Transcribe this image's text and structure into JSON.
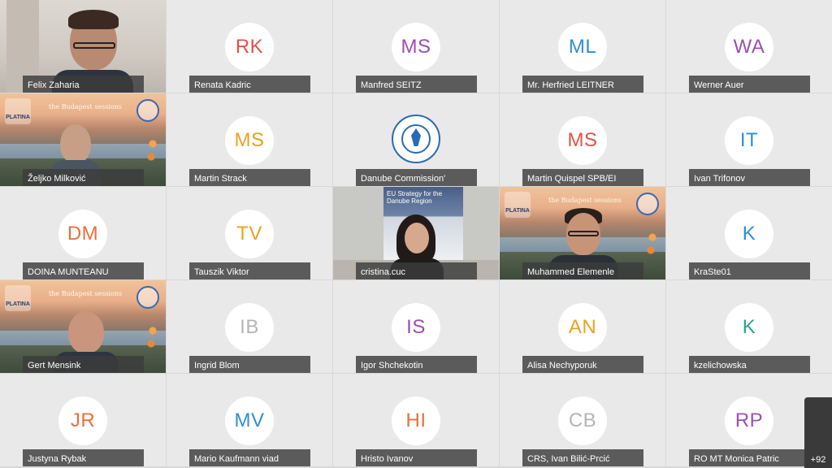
{
  "meeting": {
    "participants": [
      {
        "name": "Felix Zaharia",
        "type": "video"
      },
      {
        "name": "Renata Kadric",
        "initials": "RK",
        "color": "#e0524a"
      },
      {
        "name": "Manfred SEITZ",
        "initials": "MS",
        "color": "#9b4fb0"
      },
      {
        "name": "Mr. Herfried LEITNER",
        "initials": "ML",
        "color": "#2e8fd4"
      },
      {
        "name": "Werner Auer",
        "initials": "WA",
        "color": "#9b4fb0"
      },
      {
        "name": "Željko Milković",
        "type": "video-budapest",
        "banner": "the Budapest sessions"
      },
      {
        "name": "Martin Strack",
        "initials": "MS",
        "color": "#e8a320"
      },
      {
        "name": "Danube Commission'",
        "type": "logo"
      },
      {
        "name": "Martin Quispel SPB/EI",
        "initials": "MS",
        "color": "#e0524a"
      },
      {
        "name": "Ivan Trifonov",
        "initials": "IT",
        "color": "#2e8fd4"
      },
      {
        "name": "DOINA MUNTEANU",
        "initials": "DM",
        "color": "#e8703a"
      },
      {
        "name": "Tauszik Viktor",
        "initials": "TV",
        "color": "#e8a320"
      },
      {
        "name": "cristina.cuc",
        "type": "video-cristina",
        "banner": "EU Strategy for the Danube Region"
      },
      {
        "name": "Muhammed Elemenle",
        "type": "video-budapest",
        "banner": "the Budapest sessions"
      },
      {
        "name": "KraSte01",
        "initials": "K",
        "color": "#2e8fd4"
      },
      {
        "name": "Gert Mensink",
        "type": "video-budapest",
        "banner": "the Budapest sessions"
      },
      {
        "name": "Ingrid Blom",
        "initials": "IB",
        "color": "#b5b5b5"
      },
      {
        "name": "Igor Shchekotin",
        "initials": "IS",
        "color": "#9b4fb0"
      },
      {
        "name": "Alisa Nechyporuk",
        "initials": "AN",
        "color": "#e8a320"
      },
      {
        "name": "kzelichowska",
        "initials": "K",
        "color": "#2aa58a"
      },
      {
        "name": "Justyna Rybak",
        "initials": "JR",
        "color": "#e8703a"
      },
      {
        "name": "Mario Kaufmann viad",
        "initials": "MV",
        "color": "#2e8fd4"
      },
      {
        "name": "Hristo Ivanov",
        "initials": "HI",
        "color": "#e8703a"
      },
      {
        "name": "CRS, Ivan Bilić-Prcić",
        "initials": "CB",
        "color": "#b5b5b5"
      },
      {
        "name": "RO MT Monica Patric",
        "initials": "RP",
        "color": "#9b4fb0"
      }
    ],
    "more_count": "+92"
  }
}
